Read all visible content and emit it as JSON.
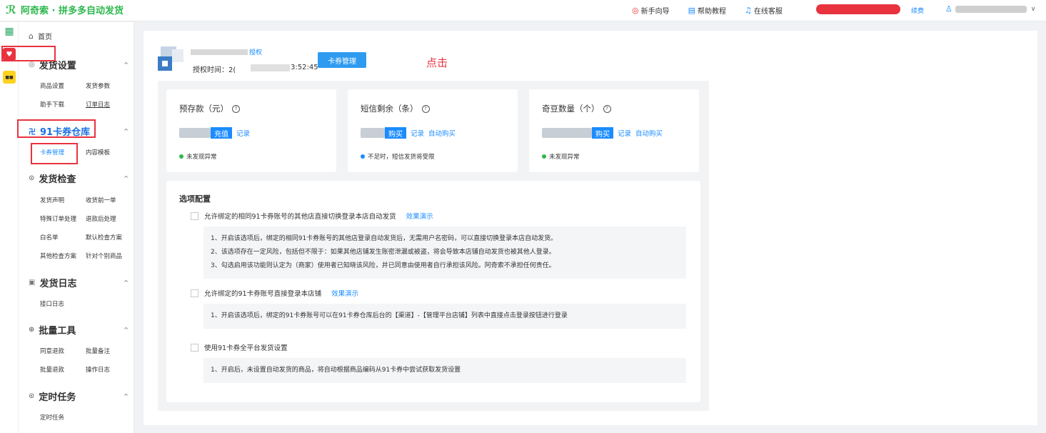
{
  "header": {
    "logo_glyph": "ℛ",
    "title": "阿奇索 · 拼多多自动发货",
    "actions": [
      {
        "icon": "compass-icon",
        "glyph": "◎",
        "label": "新手向导"
      },
      {
        "icon": "document-icon",
        "glyph": "▤",
        "label": "帮助教程"
      },
      {
        "icon": "headset-icon",
        "glyph": "♫",
        "label": "在线客服"
      }
    ],
    "renew_label": "续费",
    "user_icon": "user-icon",
    "user_glyph": "♙",
    "user_chevron": "∨"
  },
  "rail": {
    "items": [
      {
        "icon": "apps-grid-icon",
        "glyph": "▦"
      },
      {
        "icon": "pdd-heart-icon",
        "glyph": "♥"
      },
      {
        "icon": "yellow-app-icon",
        "glyph": "■■"
      }
    ]
  },
  "sidebar": {
    "home": {
      "icon": "home-icon",
      "glyph": "⌂",
      "label": "首页"
    },
    "sections": [
      {
        "key": "delivery_settings",
        "icon_glyph": "◎",
        "label": "发货设置",
        "caret": "^",
        "items": [
          "商品设置",
          "发货参数",
          "助手下载",
          "订单日志"
        ]
      },
      {
        "key": "card_repo",
        "icon_glyph": "卍",
        "label": "91卡券仓库",
        "caret": "^",
        "items": [
          "卡券管理",
          "内容模板"
        ]
      },
      {
        "key": "delivery_check",
        "icon_glyph": "⊙",
        "label": "发货检查",
        "caret": "^",
        "items": [
          "发货声明",
          "收货前一单",
          "特殊订单处理",
          "退款后处理",
          "白名单",
          "默认检查方案",
          "其他检查方案",
          "针对个别商品"
        ]
      },
      {
        "key": "delivery_log",
        "icon_glyph": "▣",
        "label": "发货日志",
        "caret": "^",
        "items": [
          "接口日志"
        ]
      },
      {
        "key": "batch_tools",
        "icon_glyph": "⊕",
        "label": "批量工具",
        "caret": "^",
        "items": [
          "同意退款",
          "批量备注",
          "批量退款",
          "操作日志"
        ]
      },
      {
        "key": "scheduled",
        "icon_glyph": "⊙",
        "label": "定时任务",
        "caret": "^",
        "items": [
          "定时任务"
        ]
      }
    ]
  },
  "shop": {
    "auth_label": "授权",
    "auth_time_label": "授权时间：2(",
    "auth_time_tail": "3:52:45"
  },
  "main": {
    "coupon_button": "卡券管理",
    "click_annotation": "点击",
    "cards": [
      {
        "title": "预存款（元）",
        "help": "?",
        "button": "充值",
        "links": [
          "记录"
        ],
        "status": "未发现异常",
        "status_color": "#2db84d"
      },
      {
        "title": "短信剩余（条）",
        "help": "?",
        "button": "购买",
        "links": [
          "记录",
          "自动购买"
        ],
        "status": "不足时，短信发货将受限",
        "status_color": "#1a8cff"
      },
      {
        "title": "奇豆数量（个）",
        "help": "?",
        "button": "购买",
        "links": [
          "记录",
          "自动购买"
        ],
        "status": "未发现异常",
        "status_color": "#2db84d"
      }
    ],
    "options_title": "选项配置",
    "options": [
      {
        "label": "允许绑定的相同91卡券账号的其他店直接切换登录本店自动发货",
        "demo": "效果演示",
        "notes": [
          "1、开启该选项后，绑定的相同91卡券账号的其他店登录自动发货后，无需用户名密码，可以直接切换登录本店自动发货。",
          "2、该选项存在一定风险，包括但不限于：如果其他店铺发生账密泄漏或被盗，将会导致本店铺自动发货也被其他人登录。",
          "3、勾选启用该功能则认定为（商家）使用者已知晓该风险，并已同意由使用者自行承担该风险。阿奇索不承担任何责任。"
        ]
      },
      {
        "label": "允许绑定的91卡券账号直接登录本店铺",
        "demo": "效果演示",
        "notes": [
          "1、开启该选项后，绑定的91卡券账号可以在91卡券仓库后台的【渠道】-【管理平台店铺】列表中直接点击登录按钮进行登录"
        ]
      },
      {
        "label": "使用91卡券全平台发货设置",
        "demo": "",
        "notes": [
          "1、开启后，未设置自动发货的商品，将自动根据商品编码从91卡券中尝试获取发货设置"
        ]
      }
    ]
  },
  "colors": {
    "brand": "#2db84d",
    "accent": "#1a8cff",
    "highlight": "#e8333f"
  }
}
